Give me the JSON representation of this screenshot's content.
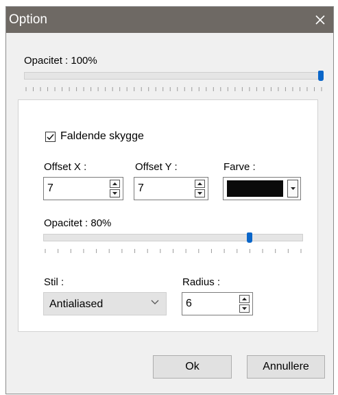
{
  "window": {
    "title": "Option",
    "close_icon": "close-icon"
  },
  "opacity": {
    "label": "Opacitet : 100%",
    "value_percent": 100
  },
  "shadow": {
    "checkbox_label": "Faldende skygge",
    "checked": true,
    "offset_x": {
      "label": "Offset X :",
      "value": "7"
    },
    "offset_y": {
      "label": "Offset Y :",
      "value": "7"
    },
    "color": {
      "label": "Farve :",
      "value": "#0a0a0a"
    },
    "opacity": {
      "label": "Opacitet : 80%",
      "value_percent": 80
    },
    "style": {
      "label": "Stil :",
      "value": "Antialiased"
    },
    "radius": {
      "label": "Radius :",
      "value": "6"
    }
  },
  "buttons": {
    "ok": "Ok",
    "cancel": "Annullere"
  },
  "colors": {
    "title_bar": "#6e6964",
    "accent": "#0a66c9",
    "background": "#f0f0f0"
  }
}
